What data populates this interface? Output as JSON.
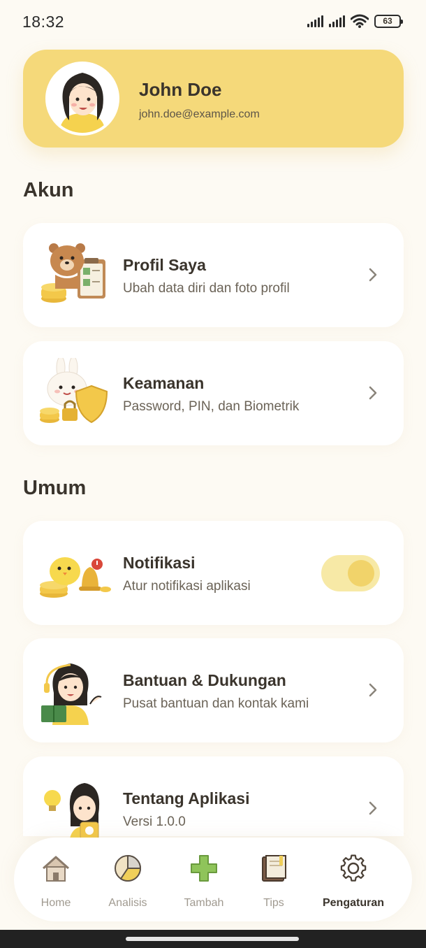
{
  "status_bar": {
    "time": "18:32",
    "battery": "63"
  },
  "profile": {
    "name": "John Doe",
    "email": "john.doe@example.com"
  },
  "sections": {
    "account": {
      "title": "Akun"
    },
    "general": {
      "title": "Umum"
    }
  },
  "cards": {
    "profile": {
      "title": "Profil Saya",
      "subtitle": "Ubah data diri dan foto profil"
    },
    "security": {
      "title": "Keamanan",
      "subtitle": "Password, PIN, dan Biometrik"
    },
    "notifications": {
      "title": "Notifikasi",
      "subtitle": "Atur notifikasi aplikasi",
      "enabled": true
    },
    "help": {
      "title": "Bantuan & Dukungan",
      "subtitle": "Pusat bantuan dan kontak kami"
    },
    "about": {
      "title": "Tentang Aplikasi",
      "subtitle": "Versi 1.0.0"
    }
  },
  "nav": {
    "home": "Home",
    "analytics": "Analisis",
    "add": "Tambah",
    "tips": "Tips",
    "settings": "Pengaturan",
    "active": "settings"
  },
  "colors": {
    "background": "#fdfaf3",
    "accent": "#f5d97a",
    "toggle_track": "#f7e9a6",
    "toggle_knob": "#f1d36a",
    "text_primary": "#3a342c",
    "text_secondary": "#6b6357"
  }
}
